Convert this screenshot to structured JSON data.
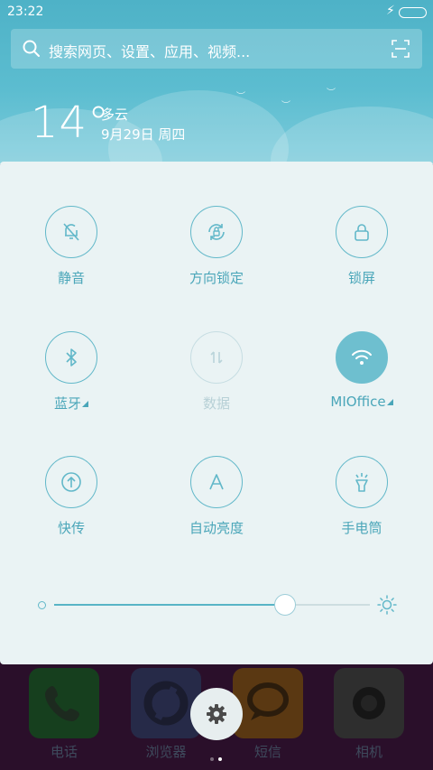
{
  "status_bar": {
    "time": "23:22"
  },
  "search": {
    "placeholder": "搜索网页、设置、应用、视频..."
  },
  "weather": {
    "temperature": "14°",
    "condition": "多云",
    "date": "9月29日 周四"
  },
  "toggles": [
    {
      "label": "静音",
      "icon": "bell-off-icon",
      "state": "off"
    },
    {
      "label": "方向锁定",
      "icon": "rotation-lock-icon",
      "state": "off"
    },
    {
      "label": "锁屏",
      "icon": "padlock-icon",
      "state": "off"
    },
    {
      "label": "蓝牙",
      "icon": "bluetooth-icon",
      "state": "off",
      "has_menu": true
    },
    {
      "label": "数据",
      "icon": "mobile-data-icon",
      "state": "disabled"
    },
    {
      "label": "MIOffice",
      "icon": "wifi-icon",
      "state": "on",
      "has_menu": true
    },
    {
      "label": "快传",
      "icon": "upload-icon",
      "state": "off"
    },
    {
      "label": "自动亮度",
      "icon": "auto-brightness-icon",
      "state": "off"
    },
    {
      "label": "手电筒",
      "icon": "flashlight-icon",
      "state": "off"
    }
  ],
  "brightness": {
    "level_percent": 73
  },
  "dock": [
    {
      "label": "电话",
      "icon": "phone-icon",
      "color": "#1f6b2c"
    },
    {
      "label": "浏览器",
      "icon": "browser-icon",
      "color": "#3b3f6c"
    },
    {
      "label": "短信",
      "icon": "message-icon",
      "color": "#8a5a1c"
    },
    {
      "label": "相机",
      "icon": "camera-icon",
      "color": "#4a4a4a"
    }
  ],
  "colors": {
    "accent": "#62b8c9",
    "panel_bg": "#eaf3f4",
    "header_bg": "#5cbdd0"
  }
}
